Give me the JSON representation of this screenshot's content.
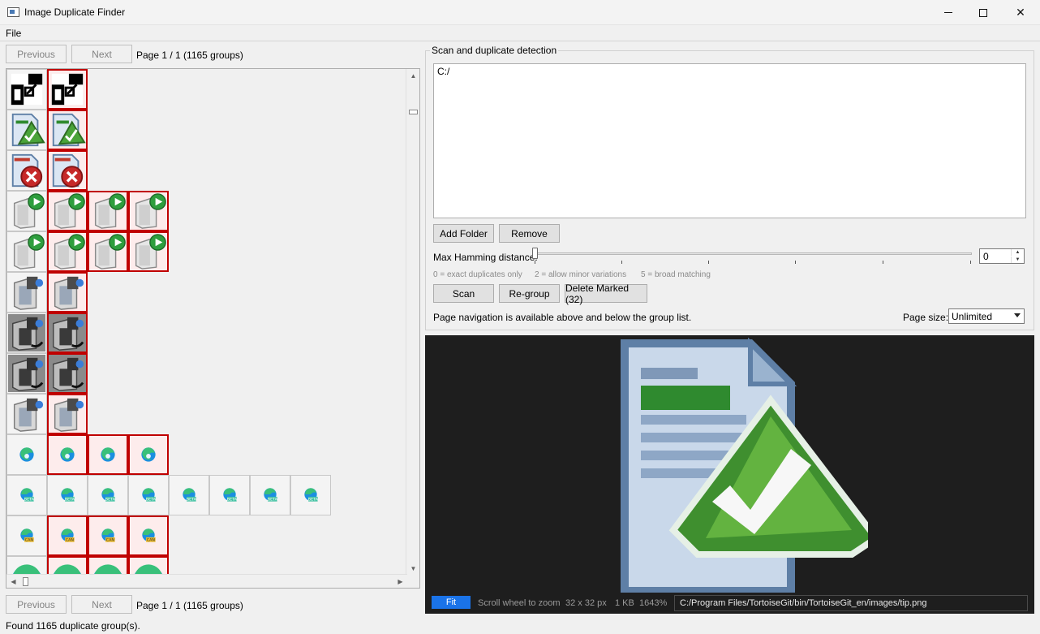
{
  "window": {
    "title": "Image Duplicate Finder",
    "controls": [
      "minimize",
      "maximize",
      "close"
    ]
  },
  "menu": {
    "file": "File"
  },
  "nav_top": {
    "previous": "Previous",
    "next": "Next",
    "page_info": "Page 1 / 1 (1165 groups)"
  },
  "nav_bottom": {
    "previous": "Previous",
    "next": "Next",
    "page_info": "Page 1 / 1 (1165 groups)"
  },
  "groups": [
    {
      "icon": "qr-shortcut-icon",
      "cells": [
        0,
        1
      ]
    },
    {
      "icon": "doc-checkmark-icon",
      "cells": [
        0,
        1
      ]
    },
    {
      "icon": "doc-error-icon",
      "cells": [
        0,
        1
      ]
    },
    {
      "icon": "server-play-icon",
      "cells": [
        0,
        1,
        1,
        1
      ]
    },
    {
      "icon": "server-play-icon",
      "cells": [
        0,
        1,
        1,
        1
      ]
    },
    {
      "icon": "media-device-icon",
      "cells": [
        0,
        1
      ]
    },
    {
      "icon": "media-drive-dark-icon",
      "cells": [
        0,
        1
      ]
    },
    {
      "icon": "media-drive-dark-icon",
      "cells": [
        0,
        1
      ]
    },
    {
      "icon": "media-device-icon",
      "cells": [
        0,
        1
      ]
    },
    {
      "icon": "edge-icon",
      "cells": [
        0,
        1,
        1,
        1
      ]
    },
    {
      "icon": "edge-beta-icon",
      "cells": [
        0,
        0,
        0,
        0,
        0,
        0,
        0,
        0
      ]
    },
    {
      "icon": "edge-canary-icon",
      "cells": [
        0,
        1,
        1,
        1
      ]
    },
    {
      "icon": "edge-large-icon",
      "cells": [
        0,
        1,
        1,
        1
      ]
    }
  ],
  "scan": {
    "group_title": "Scan and duplicate detection",
    "folders": [
      "C:/"
    ],
    "add_folder": "Add Folder",
    "remove": "Remove",
    "hamming_label": "Max Hamming distance:",
    "hamming_value": "0",
    "hint_exact": "0 = exact duplicates only",
    "hint_minor": "2 = allow minor variations",
    "hint_broad": "5 = broad matching",
    "scan_btn": "Scan",
    "regroup_btn": "Re-group",
    "delete_btn": "Delete Marked (32)",
    "nav_note": "Page navigation is available above and below the group list.",
    "page_size_label": "Page size:",
    "page_size_value": "Unlimited"
  },
  "preview": {
    "fit": "Fit",
    "zoom_hint": "Scroll wheel to zoom",
    "dimensions": "32 x 32 px",
    "filesize": "1 KB",
    "zoom": "1643%",
    "path": "C:/Program Files/TortoiseGit/bin/TortoiseGit_en/images/tip.png"
  },
  "status": "Found 1165 duplicate group(s).",
  "colors": {
    "marked_border": "#c00000",
    "fit_button": "#1a73e8",
    "preview_bg": "#1e1e1e"
  }
}
